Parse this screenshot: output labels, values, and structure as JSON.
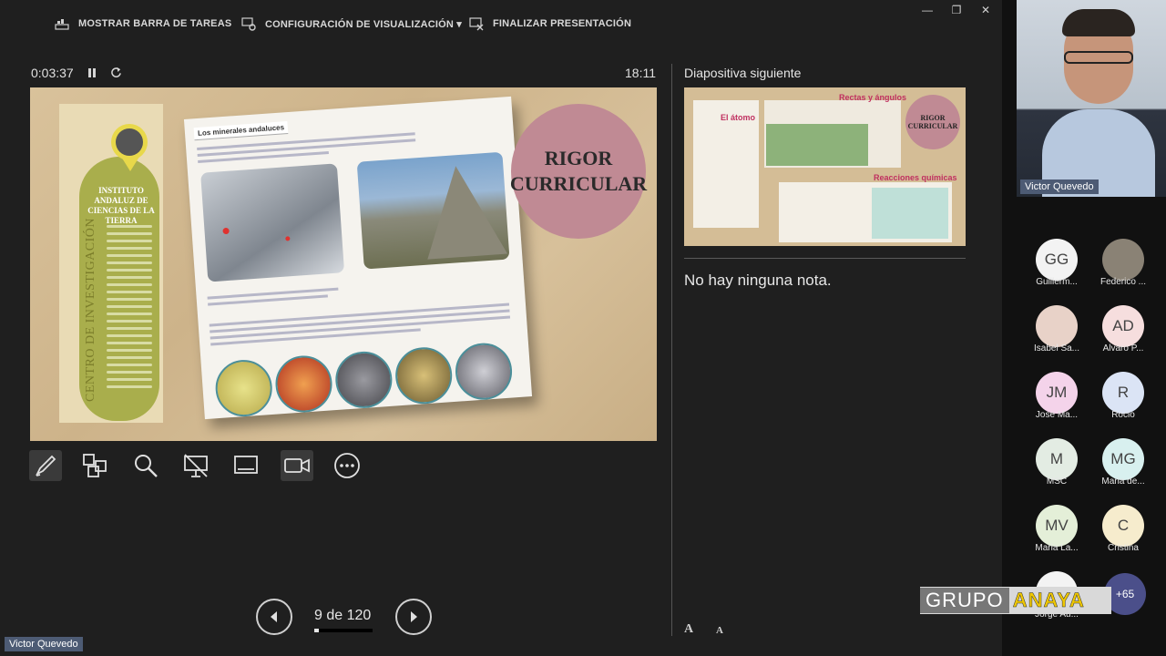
{
  "toolbar": {
    "show_taskbar": "MOSTRAR BARRA DE TAREAS",
    "display_settings": "CONFIGURACIÓN DE VISUALIZACIÓN ▾",
    "end_presentation": "FINALIZAR PRESENTACIÓN"
  },
  "window": {
    "minimize": "—",
    "restore": "❐",
    "close": "✕"
  },
  "presenter": {
    "elapsed": "0:03:37",
    "clock": "18:11",
    "pause_icon": "pause-icon",
    "restart_icon": "restart-icon"
  },
  "slide": {
    "bookmark_title": "INSTITUTO ANDALUZ DE CIENCIAS DE LA TIERRA",
    "bookmark_side": "CENTRO DE INVESTIGACIÓN",
    "page_tag": "Los minerales andaluces",
    "rigor_line1": "RIGOR",
    "rigor_line2": "CURRICULAR"
  },
  "tools": [
    "pen-icon",
    "slides-grid-icon",
    "zoom-icon",
    "black-screen-icon",
    "subtitles-icon",
    "camera-icon",
    "more-icon"
  ],
  "nav": {
    "counter": "9 de 120",
    "progress": 0.075
  },
  "next_slide": {
    "label": "Diapositiva siguiente",
    "t_atomo": "El átomo",
    "t_rectas": "Rectas y ángulos",
    "t_reacciones": "Reacciones químicas",
    "t_rigor1": "RIGOR",
    "t_rigor2": "CURRICULAR"
  },
  "notes": {
    "text": "No hay ninguna nota.",
    "font_up": "A",
    "font_down": "A"
  },
  "participants": {
    "camera_name": "Victor Quevedo",
    "list": [
      {
        "initials": "GG",
        "name": "Guillerm...",
        "color": "#f3f3f3"
      },
      {
        "initials": "",
        "name": "Federico ...",
        "color": "#8a8275"
      },
      {
        "initials": "",
        "name": "Isabel Sa...",
        "color": "#e8d2c8"
      },
      {
        "initials": "AD",
        "name": "Alvaro P...",
        "color": "#f6dede"
      },
      {
        "initials": "JM",
        "name": "Jose Ma...",
        "color": "#f4d3ea"
      },
      {
        "initials": "R",
        "name": "Rocio",
        "color": "#dbe4f5"
      },
      {
        "initials": "M",
        "name": "MSC",
        "color": "#e3ece3"
      },
      {
        "initials": "MG",
        "name": "Maria de...",
        "color": "#d8f0ef"
      },
      {
        "initials": "MV",
        "name": "Maria La...",
        "color": "#e4efd8"
      },
      {
        "initials": "C",
        "name": "Cristina",
        "color": "#f6eccd"
      },
      {
        "initials": "",
        "name": "Jorge Au...",
        "color": "#f3f3f3"
      }
    ],
    "more": "+65"
  },
  "logo": {
    "grupo": "GRUPO",
    "anaya": "ANAYA"
  },
  "self_label": "Victor Quevedo"
}
